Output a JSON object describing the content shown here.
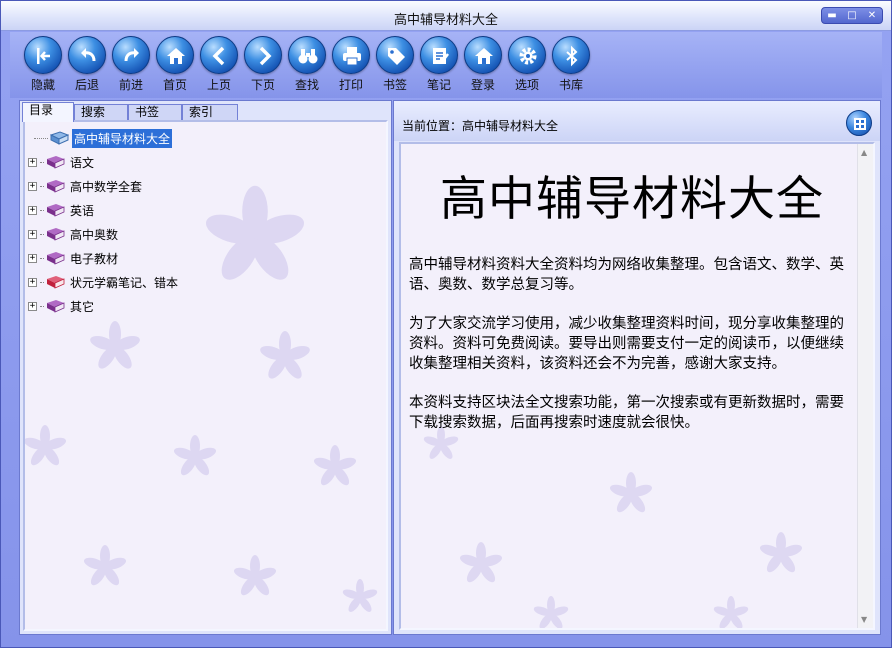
{
  "window": {
    "title": "高中辅导材料大全",
    "controls": [
      "minimize-icon",
      "maximize-icon",
      "close-icon"
    ]
  },
  "toolbar": {
    "items": [
      {
        "label": "隐藏",
        "icon": "hide-panel-icon"
      },
      {
        "label": "后退",
        "icon": "back-arrow-icon"
      },
      {
        "label": "前进",
        "icon": "forward-arrow-icon"
      },
      {
        "label": "首页",
        "icon": "home-icon"
      },
      {
        "label": "上页",
        "icon": "chevron-left-icon"
      },
      {
        "label": "下页",
        "icon": "chevron-right-icon"
      },
      {
        "label": "查找",
        "icon": "binoculars-icon"
      },
      {
        "label": "打印",
        "icon": "printer-icon"
      },
      {
        "label": "书签",
        "icon": "tag-icon"
      },
      {
        "label": "笔记",
        "icon": "note-icon"
      },
      {
        "label": "登录",
        "icon": "home-login-icon"
      },
      {
        "label": "选项",
        "icon": "gear-icon"
      },
      {
        "label": "书库",
        "icon": "bluetooth-icon"
      }
    ]
  },
  "left_tabs": [
    "目录",
    "搜索",
    "书签",
    "索引"
  ],
  "tree": {
    "root": {
      "label": "高中辅导材料大全",
      "icon": "open-book-icon",
      "selected": true
    },
    "items": [
      {
        "label": "语文",
        "icon": "book-icon"
      },
      {
        "label": "高中数学全套",
        "icon": "book-icon"
      },
      {
        "label": "英语",
        "icon": "book-icon"
      },
      {
        "label": "高中奥数",
        "icon": "book-icon"
      },
      {
        "label": "电子教材",
        "icon": "book-icon"
      },
      {
        "label": "状元学霸笔记、错本",
        "icon": "book-red-icon"
      },
      {
        "label": "其它",
        "icon": "book-icon"
      }
    ]
  },
  "location": {
    "text": "当前位置：高中辅导材料大全",
    "button_icon": "grid-icon"
  },
  "document": {
    "title": "高中辅导材料大全",
    "paragraphs": [
      "高中辅导材料资料大全资料均为网络收集整理。包含语文、数学、英语、奥数、数学总复习等。",
      "为了大家交流学习使用，减少收集整理资料时间，现分享收集整理的资料。资料可免费阅读。要导出则需要支付一定的阅读币，以便继续收集整理相关资料，该资料还会不为完善，感谢大家支持。",
      "本资料支持区块法全文搜索功能，第一次搜索或有更新数据时，需要下载搜索数据，后面再搜索时速度就会很快。"
    ]
  },
  "colors": {
    "frame": "#8c9bec",
    "selection": "#2c6fd8",
    "button_blue": "#1553b4",
    "book_purple": "#7a2f8c",
    "flower": "#c8c8f0"
  }
}
